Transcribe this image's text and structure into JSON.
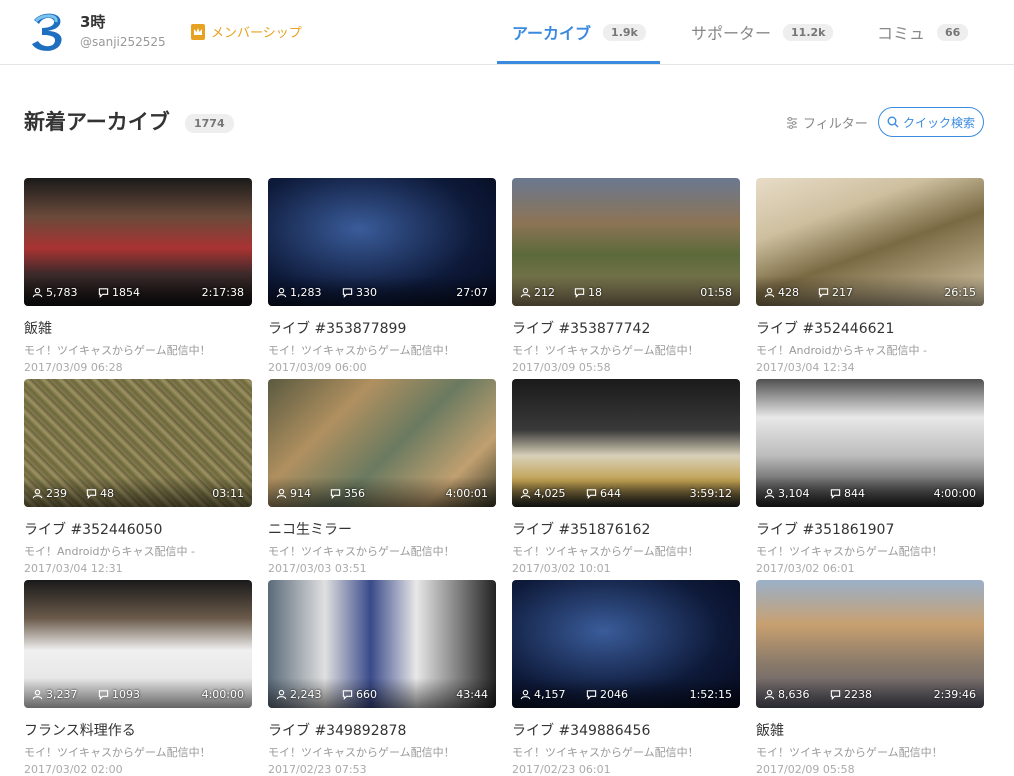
{
  "user": {
    "name": "3時",
    "id": "@sanji252525"
  },
  "membership_label": "メンバーシップ",
  "tabs": [
    {
      "label": "アーカイブ",
      "count": "1.9k"
    },
    {
      "label": "サポーター",
      "count": "11.2k"
    },
    {
      "label": "コミュ",
      "count": "66"
    }
  ],
  "section": {
    "title": "新着アーカイブ",
    "count": "1774",
    "filter_label": "フィルター",
    "search_label": "クイック検索"
  },
  "colors": {
    "accent": "#3a8be0",
    "membership": "#e8a221"
  },
  "cards": [
    {
      "title": "飯雑",
      "subtitle": "モイ！ツイキャスからゲーム配信中！",
      "date": "2017/03/09 06:28",
      "views": "5,783",
      "comments": "1854",
      "duration": "2:17:38",
      "thumb": "thumb-1"
    },
    {
      "title": "ライブ #353877899",
      "subtitle": "モイ！ツイキャスからゲーム配信中！",
      "date": "2017/03/09 06:00",
      "views": "1,283",
      "comments": "330",
      "duration": "27:07",
      "thumb": "thumb-2"
    },
    {
      "title": "ライブ #353877742",
      "subtitle": "モイ！ツイキャスからゲーム配信中！",
      "date": "2017/03/09 05:58",
      "views": "212",
      "comments": "18",
      "duration": "01:58",
      "thumb": "thumb-3"
    },
    {
      "title": "ライブ #352446621",
      "subtitle": "モイ！Androidからキャス配信中 -",
      "date": "2017/03/04 12:34",
      "views": "428",
      "comments": "217",
      "duration": "26:15",
      "thumb": "thumb-4"
    },
    {
      "title": "ライブ #352446050",
      "subtitle": "モイ！Androidからキャス配信中 -",
      "date": "2017/03/04 12:31",
      "views": "239",
      "comments": "48",
      "duration": "03:11",
      "thumb": "thumb-5"
    },
    {
      "title": "ニコ生ミラー",
      "subtitle": "モイ！ツイキャスからゲーム配信中！",
      "date": "2017/03/03 03:51",
      "views": "914",
      "comments": "356",
      "duration": "4:00:01",
      "thumb": "thumb-6"
    },
    {
      "title": "ライブ #351876162",
      "subtitle": "モイ！ツイキャスからゲーム配信中！",
      "date": "2017/03/02 10:01",
      "views": "4,025",
      "comments": "644",
      "duration": "3:59:12",
      "thumb": "thumb-7"
    },
    {
      "title": "ライブ #351861907",
      "subtitle": "モイ！ツイキャスからゲーム配信中！",
      "date": "2017/03/02 06:01",
      "views": "3,104",
      "comments": "844",
      "duration": "4:00:00",
      "thumb": "thumb-8"
    },
    {
      "title": "フランス料理作る",
      "subtitle": "モイ！ツイキャスからゲーム配信中！",
      "date": "2017/03/02 02:00",
      "views": "3,237",
      "comments": "1093",
      "duration": "4:00:00",
      "thumb": "thumb-9"
    },
    {
      "title": "ライブ #349892878",
      "subtitle": "モイ！ツイキャスからゲーム配信中！",
      "date": "2017/02/23 07:53",
      "views": "2,243",
      "comments": "660",
      "duration": "43:44",
      "thumb": "thumb-10"
    },
    {
      "title": "ライブ #349886456",
      "subtitle": "モイ！ツイキャスからゲーム配信中！",
      "date": "2017/02/23 06:01",
      "views": "4,157",
      "comments": "2046",
      "duration": "1:52:15",
      "thumb": "thumb-11"
    },
    {
      "title": "飯雑",
      "subtitle": "モイ！ツイキャスからゲーム配信中！",
      "date": "2017/02/09 05:58",
      "views": "8,636",
      "comments": "2238",
      "duration": "2:39:46",
      "thumb": "thumb-12"
    }
  ]
}
